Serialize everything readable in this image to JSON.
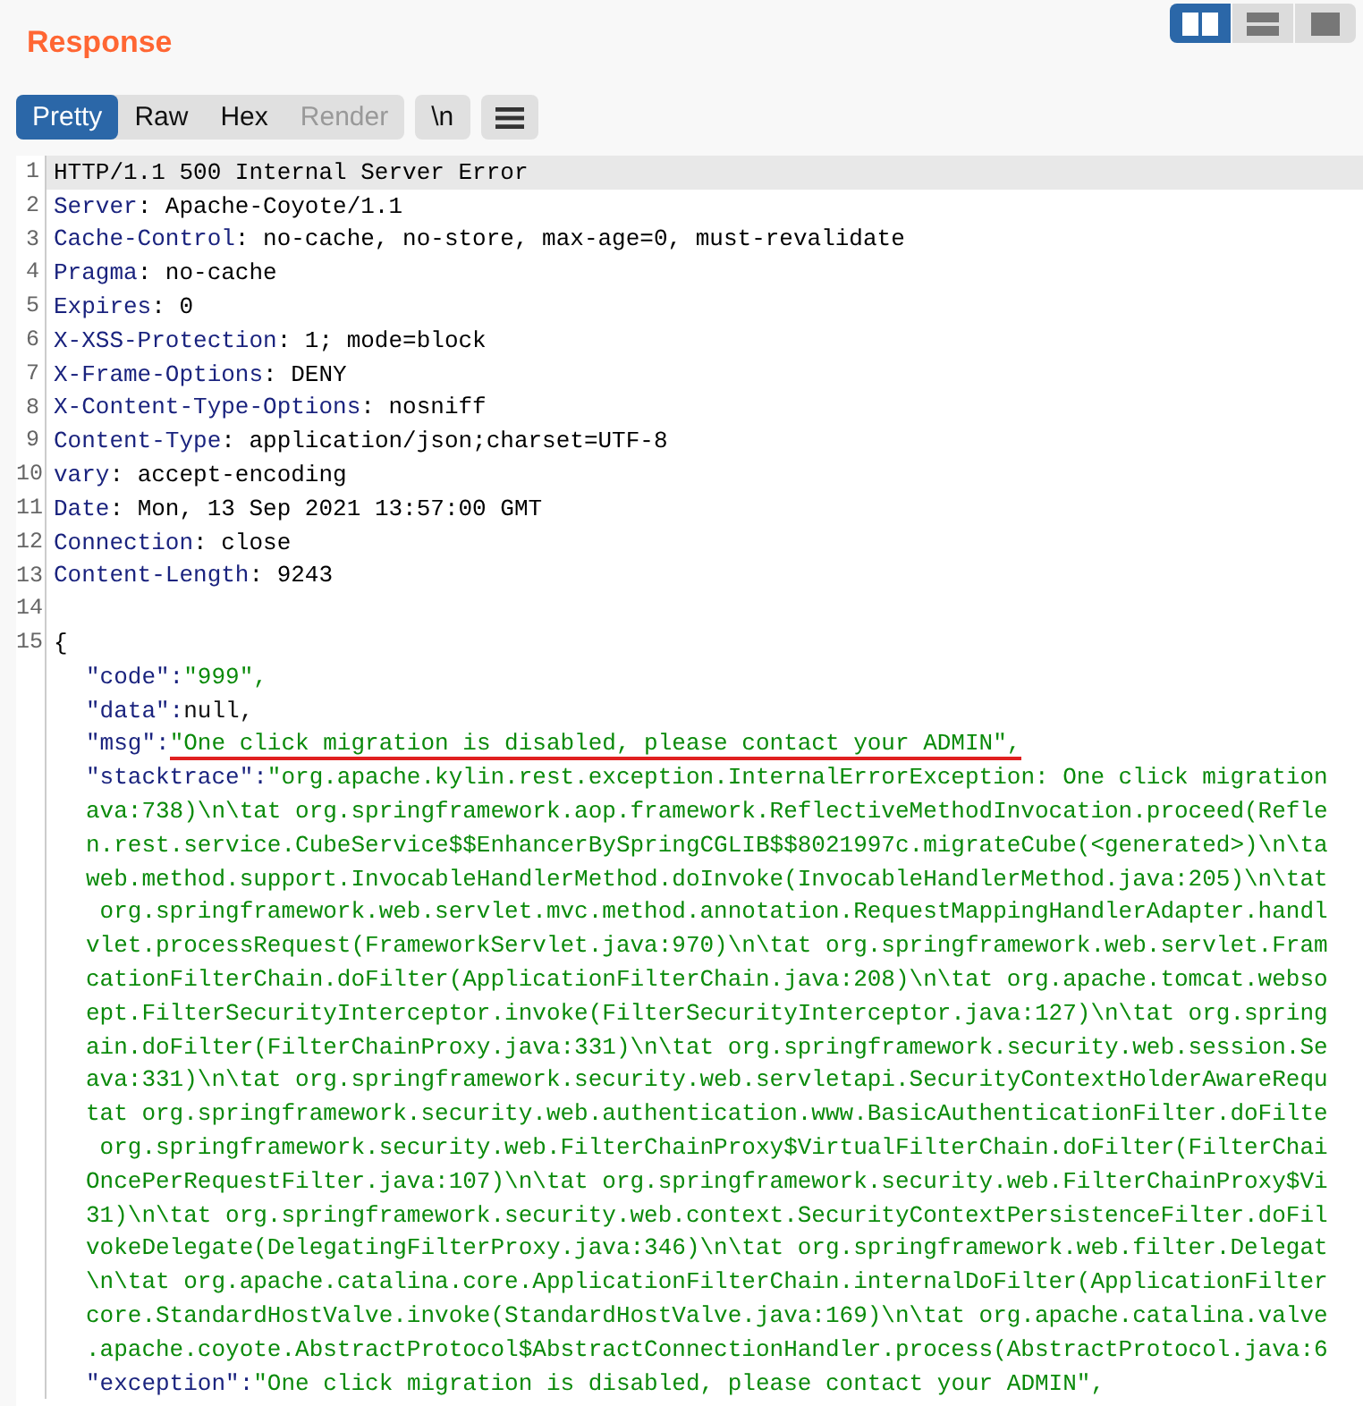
{
  "panel": {
    "title": "Response"
  },
  "layout_toggle": [
    {
      "selected": true
    },
    {
      "selected": false
    },
    {
      "selected": false
    }
  ],
  "view_tabs": [
    {
      "label": "Pretty",
      "selected": true,
      "disabled": false
    },
    {
      "label": "Raw",
      "selected": false,
      "disabled": false
    },
    {
      "label": "Hex",
      "selected": false,
      "disabled": false
    },
    {
      "label": "Render",
      "selected": false,
      "disabled": true
    }
  ],
  "newline_button": {
    "label": "\\n"
  },
  "editor": {
    "header_lines": [
      {
        "number": "1",
        "kind": "status",
        "text": "HTTP/1.1 500 Internal Server Error",
        "selected": true
      },
      {
        "number": "2",
        "kind": "header",
        "name": "Server",
        "value": ": Apache-Coyote/1.1",
        "selected": false
      },
      {
        "number": "3",
        "kind": "header",
        "name": "Cache-Control",
        "value": ": no-cache, no-store, max-age=0, must-revalidate",
        "selected": false
      },
      {
        "number": "4",
        "kind": "header",
        "name": "Pragma",
        "value": ": no-cache",
        "selected": false
      },
      {
        "number": "5",
        "kind": "header",
        "name": "Expires",
        "value": ": 0",
        "selected": false
      },
      {
        "number": "6",
        "kind": "header",
        "name": "X-XSS-Protection",
        "value": ": 1; mode=block",
        "selected": false
      },
      {
        "number": "7",
        "kind": "header",
        "name": "X-Frame-Options",
        "value": ": DENY",
        "selected": false
      },
      {
        "number": "8",
        "kind": "header",
        "name": "X-Content-Type-Options",
        "value": ": nosniff",
        "selected": false
      },
      {
        "number": "9",
        "kind": "header",
        "name": "Content-Type",
        "value": ": application/json;charset=UTF-8",
        "selected": false
      },
      {
        "number": "10",
        "kind": "header",
        "name": "vary",
        "value": ": accept-encoding",
        "selected": false
      },
      {
        "number": "11",
        "kind": "header",
        "name": "Date",
        "value": ": Mon, 13 Sep 2021 13:57:00 GMT",
        "selected": false
      },
      {
        "number": "12",
        "kind": "header",
        "name": "Connection",
        "value": ": close",
        "selected": false
      },
      {
        "number": "13",
        "kind": "header",
        "name": "Content-Length",
        "value": ": 9243",
        "selected": false
      },
      {
        "number": "14",
        "kind": "blank",
        "selected": false
      },
      {
        "number": "15",
        "kind": "brace",
        "text": "{",
        "selected": false
      }
    ],
    "body_entries": [
      {
        "key": "\"code\":",
        "kind": "string",
        "underlined": false,
        "lines": [
          "\"999\","
        ]
      },
      {
        "key": "\"data\":",
        "kind": "literal",
        "underlined": false,
        "lines": [
          "null,"
        ]
      },
      {
        "key": "\"msg\":",
        "kind": "string",
        "underlined": true,
        "lines": [
          "\"One click migration is disabled, please contact your ADMIN\","
        ]
      },
      {
        "key": "\"stacktrace\":",
        "kind": "string",
        "underlined": false,
        "lines": [
          "\"org.apache.kylin.rest.exception.InternalErrorException: One click migration",
          "ava:738)\\n\\tat org.springframework.aop.framework.ReflectiveMethodInvocation.proceed(Refle",
          "n.rest.service.CubeService$$EnhancerBySpringCGLIB$$8021997c.migrateCube(<generated>)\\n\\ta",
          "web.method.support.InvocableHandlerMethod.doInvoke(InvocableHandlerMethod.java:205)\\n\\tat",
          " org.springframework.web.servlet.mvc.method.annotation.RequestMappingHandlerAdapter.handl",
          "vlet.processRequest(FrameworkServlet.java:970)\\n\\tat org.springframework.web.servlet.Fram",
          "cationFilterChain.doFilter(ApplicationFilterChain.java:208)\\n\\tat org.apache.tomcat.webso",
          "ept.FilterSecurityInterceptor.invoke(FilterSecurityInterceptor.java:127)\\n\\tat org.spring",
          "ain.doFilter(FilterChainProxy.java:331)\\n\\tat org.springframework.security.web.session.Se",
          "ava:331)\\n\\tat org.springframework.security.web.servletapi.SecurityContextHolderAwareRequ",
          "tat org.springframework.security.web.authentication.www.BasicAuthenticationFilter.doFilte",
          " org.springframework.security.web.FilterChainProxy$VirtualFilterChain.doFilter(FilterChai",
          "OncePerRequestFilter.java:107)\\n\\tat org.springframework.security.web.FilterChainProxy$Vi",
          "31)\\n\\tat org.springframework.security.web.context.SecurityContextPersistenceFilter.doFil",
          "vokeDelegate(DelegatingFilterProxy.java:346)\\n\\tat org.springframework.web.filter.Delegat",
          "\\n\\tat org.apache.catalina.core.ApplicationFilterChain.internalDoFilter(ApplicationFilter",
          "core.StandardHostValve.invoke(StandardHostValve.java:169)\\n\\tat org.apache.catalina.valve",
          ".apache.coyote.AbstractProtocol$AbstractConnectionHandler.process(AbstractProtocol.java:6"
        ]
      },
      {
        "key": "\"exception\":",
        "kind": "string",
        "underlined": false,
        "lines": [
          "\"One click migration is disabled, please contact your ADMIN\","
        ]
      }
    ]
  }
}
